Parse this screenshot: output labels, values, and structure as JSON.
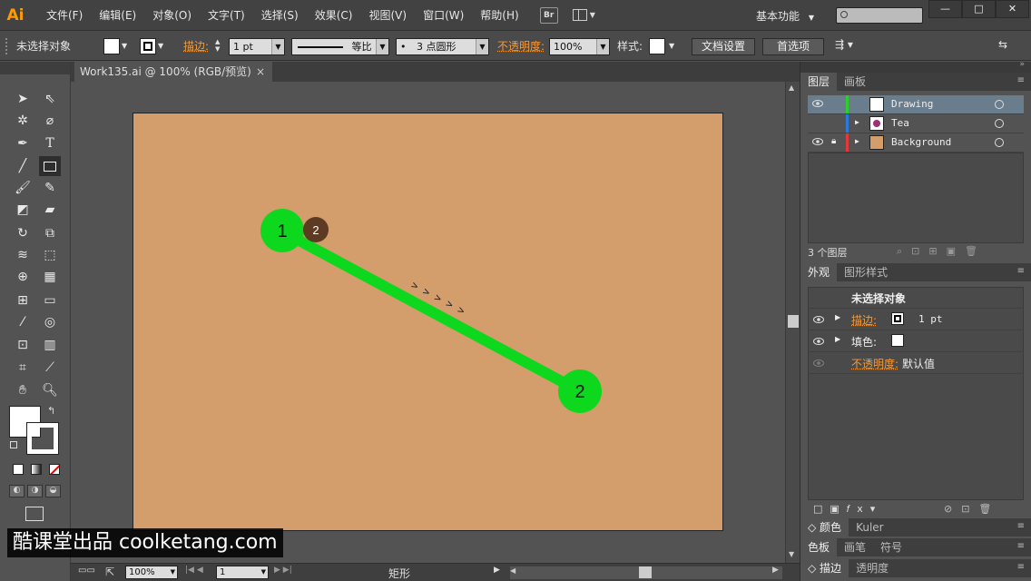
{
  "app": {
    "logo": "Ai"
  },
  "menu": {
    "items": [
      "文件(F)",
      "编辑(E)",
      "对象(O)",
      "文字(T)",
      "选择(S)",
      "效果(C)",
      "视图(V)",
      "窗口(W)",
      "帮助(H)"
    ],
    "bridge": "Br",
    "workspace": "基本功能"
  },
  "window_controls": [
    "—",
    "□",
    "✕"
  ],
  "control": {
    "selection": "未选择对象",
    "stroke_label": "描边:",
    "stroke_weight": "1 pt",
    "profile": "等比",
    "brush": "3 点圆形",
    "opacity_label": "不透明度:",
    "opacity_value": "100%",
    "style_label": "样式:",
    "doc_setup": "文档设置",
    "preferences": "首选项"
  },
  "document": {
    "tab_title": "Work135.ai @ 100% (RGB/预览)",
    "close": "×"
  },
  "artwork": {
    "start_label": "1",
    "end_label": "2",
    "step_label": "2",
    "arrows": "> > > > >",
    "line_color": "#0ed81e",
    "artboard_color": "#d49d6c"
  },
  "status": {
    "zoom": "100%",
    "page": "1",
    "tool": "矩形"
  },
  "layers_panel": {
    "tabs": [
      "图层",
      "画板"
    ],
    "layers": [
      {
        "name": "Drawing",
        "color": "#2bd12b"
      },
      {
        "name": "Tea",
        "color": "#2b7ae0"
      },
      {
        "name": "Background",
        "color": "#e03a3a"
      }
    ],
    "count": "3 个图层"
  },
  "appearance_panel": {
    "tabs": [
      "外观",
      "图形样式"
    ],
    "title": "未选择对象",
    "stroke_label": "描边:",
    "stroke_value": "1 pt",
    "fill_label": "填色:",
    "opacity_label": "不透明度:",
    "opacity_value": "默认值"
  },
  "collapsed_panels": [
    {
      "tabs": [
        "颜色",
        "Kuler"
      ]
    },
    {
      "tabs": [
        "色板",
        "画笔",
        "符号"
      ]
    },
    {
      "tabs": [
        "描边",
        "透明度"
      ]
    }
  ],
  "watermark": "酷课堂出品 coolketang.com"
}
